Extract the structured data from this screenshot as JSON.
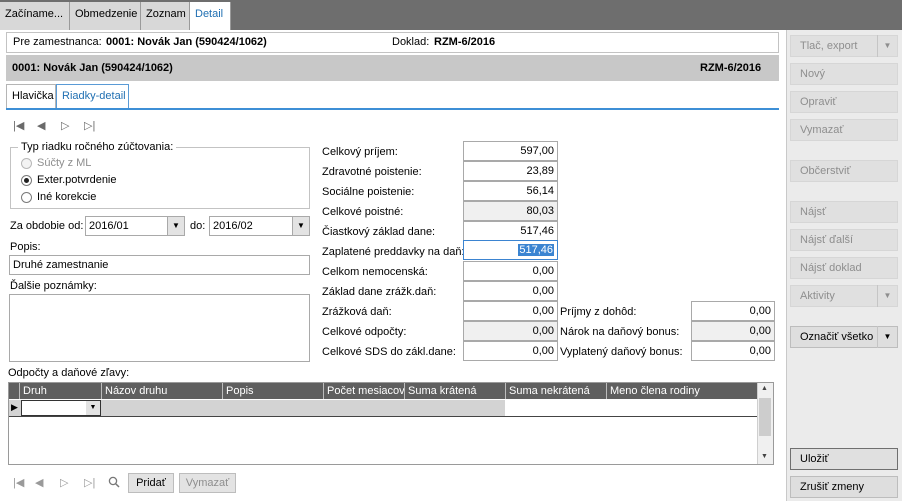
{
  "tabs": [
    "Začíname...",
    "Obmedzenie",
    "Zoznam",
    "Detail"
  ],
  "employee_bar": {
    "label": "Pre zamestnanca:",
    "value": "0001: Novák Jan (590424/1062)",
    "doc_label": "Doklad:",
    "doc_value": "RZM-6/2016"
  },
  "header": {
    "title": "0001: Novák Jan (590424/1062)",
    "doc": "RZM-6/2016"
  },
  "subtabs": [
    "Hlavička",
    "Riadky-detail"
  ],
  "nav_glyphs": [
    "|◀",
    "◀",
    "▷",
    "▷|"
  ],
  "group": {
    "title": "Typ riadku ročného zúčtovania:",
    "options": [
      "Súčty z ML",
      "Exter.potvrdenie",
      "Iné korekcie"
    ]
  },
  "period": {
    "from_label": "Za obdobie od:",
    "from_value": "2016/01",
    "to_label": "do:",
    "to_value": "2016/02"
  },
  "popis": {
    "label": "Popis:",
    "value": "Druhé zamestnanie"
  },
  "notes_label": "Ďalšie poznámky:",
  "values": [
    {
      "label": "Celkový príjem:",
      "value": "597,00"
    },
    {
      "label": "Zdravotné poistenie:",
      "value": "23,89"
    },
    {
      "label": "Sociálne poistenie:",
      "value": "56,14"
    },
    {
      "label": "Celkové poistné:",
      "value": "80,03"
    },
    {
      "label": "Čiastkový základ dane:",
      "value": "517,46"
    },
    {
      "label": "Zaplatené preddavky na daň:",
      "value": "517,46"
    },
    {
      "label": "Celkom nemocenská:",
      "value": "0,00"
    },
    {
      "label": "Základ dane zrážk.daň:",
      "value": "0,00"
    },
    {
      "label": "Zrážková daň:",
      "value": "0,00"
    },
    {
      "label": "Celkové odpočty:",
      "value": "0,00"
    },
    {
      "label": "Celkové SDS do zákl.dane:",
      "value": "0,00"
    }
  ],
  "right_values": [
    {
      "label": "Príjmy z dohôd:",
      "value": "0,00"
    },
    {
      "label": "Nárok na daňový bonus:",
      "value": "0,00"
    },
    {
      "label": "Vyplatený daňový bonus:",
      "value": "0,00"
    }
  ],
  "grid": {
    "title": "Odpočty a daňové zľavy:",
    "columns": [
      "Druh",
      "Názov druhu",
      "Popis",
      "Počet mesiacov",
      "Suma krátená",
      "Suma nekrátená",
      "Meno člena rodiny"
    ]
  },
  "bottom": {
    "add": "Pridať",
    "delete": "Vymazať"
  },
  "sidebar": {
    "print": "Tlač, export",
    "new": "Nový",
    "edit": "Opraviť",
    "delete": "Vymazať",
    "refresh": "Občerstviť",
    "find": "Nájsť",
    "find_next": "Nájsť ďalší",
    "find_doc": "Nájsť doklad",
    "activities": "Aktivity",
    "select_all": "Označiť všetko",
    "save": "Uložiť",
    "cancel": "Zrušiť zmeny"
  }
}
